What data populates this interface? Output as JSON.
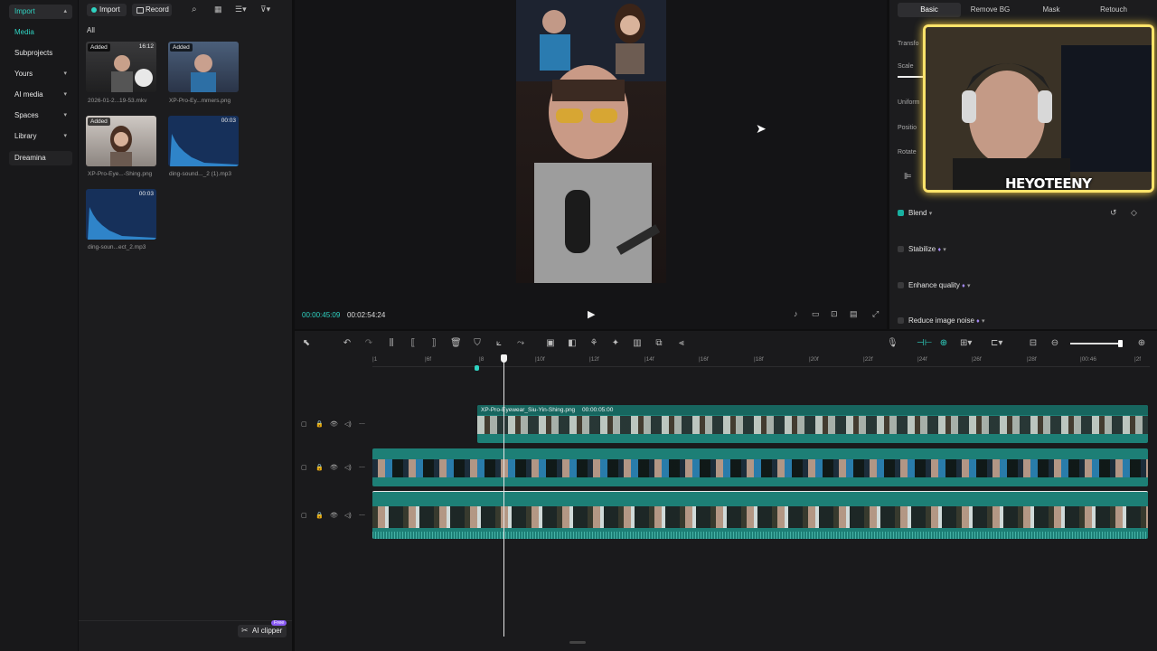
{
  "sidebar": {
    "header": "Import",
    "items": [
      {
        "label": "Media",
        "active": true
      },
      {
        "label": "Subprojects"
      },
      {
        "label": "Yours"
      },
      {
        "label": "AI media"
      },
      {
        "label": "Spaces"
      },
      {
        "label": "Library"
      },
      {
        "label": "Dreamina"
      }
    ]
  },
  "media_toolbar": {
    "import_label": "Import",
    "record_label": "Record",
    "filter_all": "All"
  },
  "media_items": [
    {
      "tag": "Added",
      "duration": "16:12",
      "caption": "2026-01-2...19-53.mkv"
    },
    {
      "tag": "Added",
      "duration": "",
      "caption": "XP-Pro-Ey...mmers.png"
    },
    {
      "tag": "Added",
      "duration": "",
      "caption": "XP-Pro-Eye...-Shing.png"
    },
    {
      "tag": "",
      "duration": "00:03",
      "caption": "ding-sound..._2 (1).mp3"
    },
    {
      "tag": "",
      "duration": "00:03",
      "caption": "ding-soun...ect_2.mp3"
    }
  ],
  "ai_clipper": {
    "label": "AI clipper",
    "badge": "Free"
  },
  "player": {
    "current_time": "00:00:45:09",
    "total_time": "00:02:54:24"
  },
  "right_panel": {
    "tabs": [
      "Basic",
      "Remove BG",
      "Mask",
      "Retouch"
    ],
    "active_tab": "Basic",
    "props": [
      "Transfo",
      "Scale",
      "Uniform",
      "Positio",
      "Rotate"
    ],
    "options": [
      {
        "label": "Blend",
        "checked": true
      },
      {
        "label": "Stabilize",
        "checked": false
      },
      {
        "label": "Enhance quality",
        "checked": false
      },
      {
        "label": "Reduce image noise",
        "checked": false
      }
    ],
    "overlay_brand": "HEYOTEENY"
  },
  "timeline": {
    "ruler_labels": [
      "|1",
      "|6f",
      "|8",
      "|10f",
      "|12f",
      "|14f",
      "|16f",
      "|18f",
      "|20f",
      "|22f",
      "|24f",
      "|26f",
      "|28f",
      "|00:46",
      "|2f"
    ],
    "clip_label": "XP-Pro-Eyewear_Siu-Yin-Shing.png",
    "clip_duration": "00:00:05:00"
  },
  "colors": {
    "accent": "#18b0a0",
    "track_teal": "#1d7f76",
    "highlight": "#ffe36a"
  },
  "icons": [
    "search-icon",
    "grid-view-icon",
    "sort-icon",
    "filter-icon",
    "play-icon",
    "undo-icon",
    "redo-icon",
    "split-icon",
    "delete-icon",
    "crop-icon",
    "zoom-out-icon",
    "zoom-in-icon",
    "mic-icon",
    "lock-icon",
    "eye-icon",
    "audio-icon",
    "more-icon",
    "mouse-cursor-icon"
  ]
}
